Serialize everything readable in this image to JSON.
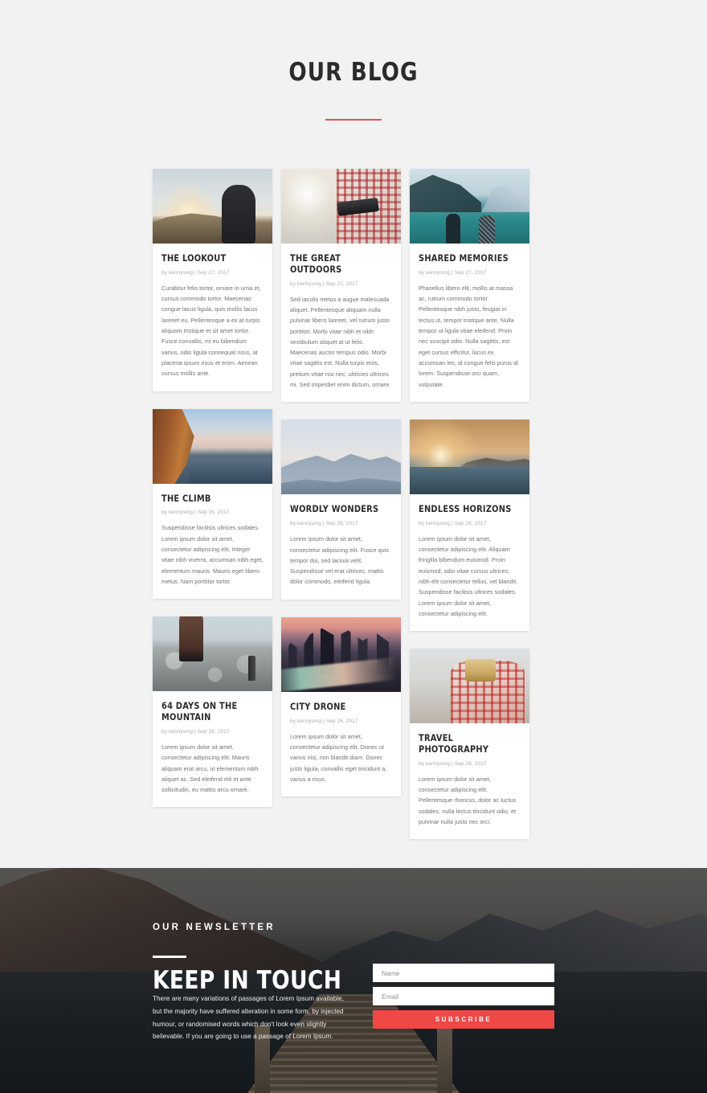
{
  "header": {
    "title": "OUR BLOG"
  },
  "posts": [
    {
      "title": "THE LOOKOUT",
      "meta": "by kennysing | Sep 27, 2017",
      "excerpt": "Curabitur felis tortor, ornare in urna et, cursus commodo tortor. Maecenas congue lacus ligula, quis mollis lacus laoreet eu. Pellentesque a ex at turpis aliquam tristique et sit amet tortor. Fusce convallis, mi eu bibendum varius, odio ligula consequat risus, at placerat ipsum risus et enim. Aenean cursus mollis ante.",
      "image_alt": "man standing on ridge at sunset"
    },
    {
      "title": "THE GREAT OUTDOORS",
      "meta": "by kennysing | Sep 27, 2017",
      "excerpt": "Sed iaculis metus a augue malesuada aliquet. Pellentesque aliquam nulla pulvinar libero laoreet, vel rutrum justo porttitor. Morbi vitae nibh et nibh vestibulum aliquet at ut felis. Maecenas auctor tempus odio. Morbi vitae sagittis est. Nulla turpis eros, pretium vitae nisi nec, ultricies ultrices mi. Sed imperdiet enim dictum, ornare.",
      "image_alt": "person in plaid shirt holding thermos"
    },
    {
      "title": "SHARED MEMORIES",
      "meta": "by kennysing | Sep 27, 2017",
      "excerpt": "Phasellus libero elit, mollis at massa ac, rutrum commodo tortor. Pellentesque nibh justo, feugiat in lectus ut, tempor tristique ante. Nulla tempor ut ligula vitae eleifend. Proin nec suscipit odio. Nulla sagittis, est eget cursus efficitur, lacus ex accumsan leo, id congue felis purus id lorem. Suspendisse orci quam, vulputate.",
      "image_alt": "two people looking at turquoise lake"
    },
    {
      "title": "THE CLIMB",
      "meta": "by kennysing | Sep 26, 2017",
      "excerpt": "Suspendisse facilisis ultrices sodales. Lorem ipsum dolor sit amet, consectetur adipiscing elit. Integer vitae nibh viverra, accumsan nibh eget, elementum mauris. Mauris eget libero metus. Nam porttitor tortor.",
      "image_alt": "red sea cliff with lighthouse at dusk"
    },
    {
      "title": "WORDLY WONDERS",
      "meta": "by kennysing | Sep 26, 2017",
      "excerpt": "Lorem ipsum dolor sit amet, consectetur adipiscing elit. Fusce quis tempor dui, sed lacinia velit. Suspendisse vel erat ultrices, mattis dolor commodo, eleifend ligula.",
      "image_alt": "hazy layered blue mountains over a lake"
    },
    {
      "title": "ENDLESS HORIZONS",
      "meta": "by kennysing | Sep 26, 2017",
      "excerpt": "Lorem ipsum dolor sit amet, consectetur adipiscing elit. Aliquam fringilla bibendum euismod. Proin euismod, odio vitae cursus ultrices, nibh elit consectetur tellus, vel blandit. Suspendisse facilisis ultrices sodales. Lorem ipsum dolor sit amet, consectetur adipiscing elit.",
      "image_alt": "golden sun setting over misty sea"
    },
    {
      "title": "64 DAYS ON THE MOUNTAIN",
      "meta": "by kennysing | Sep 26, 2017",
      "excerpt": "Lorem ipsum dolor sit amet, consectetur adipiscing elit. Mauris aliquam erat arcu, ut elementum nibh aliquet ac. Sed eleifend elit et ante sollicitudin, eu mattis arcu ornare.",
      "image_alt": "legs standing on rocks near a water bottle"
    },
    {
      "title": "CITY DRONE",
      "meta": "by kennysing | Sep 26, 2017",
      "excerpt": "Lorem ipsum dolor sit amet, consectetur adipiscing elit. Donec ut varius nisi, non blandit diam. Donec justo ligula, convallis eget tincidunt a, varius a risus.",
      "image_alt": "dusk city skyline with highway light trails"
    },
    {
      "title": "TRAVEL PHOTOGRAPHY",
      "meta": "by kennysing | Sep 26, 2017",
      "excerpt": "Lorem ipsum dolor sit amet, consectetur adipiscing elit. Pellentesque rhoncus, dolor ac luctus sodales, nulla lectus tincidunt odio, et pulvinar nulla justo nec orci.",
      "image_alt": "person in plaid shirt holding a camera"
    }
  ],
  "newsletter": {
    "eyebrow": "OUR NEWSLETTER",
    "heading": "KEEP IN TOUCH",
    "body": "There are many variations of passages of Lorem Ipsum available, but the majority have suffered alteration in some form, by injected humour, or randomised words which don't look even slightly believable. If you are going to use a passage of Lorem Ipsum.",
    "name_placeholder": "Name",
    "name_value": "",
    "email_placeholder": "Email",
    "email_value": "",
    "submit_label": "SUBSCRIBE",
    "background_alt": "mountain lake at dusk with wooden dock"
  },
  "colors": {
    "accent": "#e0534f",
    "button": "#ef4845",
    "page_bg": "#f2f2f2",
    "card_bg": "#ffffff",
    "heading": "#2b2b2b",
    "body_text": "#6f6f6f",
    "meta_text": "#a8a8a8"
  }
}
